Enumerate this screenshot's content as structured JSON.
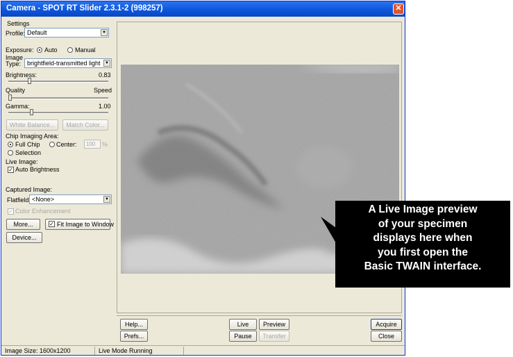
{
  "window": {
    "title": "Camera - SPOT RT Slider 2.3.1-2  (998257)"
  },
  "settings": {
    "group_label": "Settings",
    "profile_label": "Profile:",
    "profile_value": "Default",
    "exposure_label": "Exposure:",
    "exposure_auto": "Auto",
    "exposure_manual": "Manual",
    "exposure_selected": "Auto",
    "image_type_label_1": "Image",
    "image_type_label_2": "Type:",
    "image_type_value": "brightfield-transmitted light",
    "brightness_label": "Brightness:",
    "brightness_value": "0.83",
    "brightness_level": 0.2,
    "quality_label": "Quality",
    "speed_label": "Speed",
    "quality_level": 0.0,
    "gamma_label": "Gamma:",
    "gamma_value": "1.00",
    "gamma_level": 0.22,
    "white_balance_label": "White Balance...",
    "match_color_label": "Match Color...",
    "chip_area_label": "Chip Imaging Area:",
    "full_chip_label": "Full Chip",
    "center_label": "Center:",
    "center_value": "100",
    "center_unit": "%",
    "selection_label": "Selection",
    "live_image_label": "Live Image:",
    "auto_brightness_label": "Auto Brightness",
    "auto_brightness_checked": true
  },
  "captured": {
    "section_label": "Captured Image:",
    "flatfield_label": "Flatfield:",
    "flatfield_value": "<None>",
    "color_enhancement_label": "Color Enhancement",
    "more_label": "More...",
    "fit_label": "Fit Image to Window",
    "fit_checked": true,
    "device_label": "Device..."
  },
  "bottom_buttons": {
    "help": "Help...",
    "prefs": "Prefs...",
    "live": "Live",
    "pause": "Pause",
    "preview": "Preview",
    "transfer": "Transfer",
    "acquire": "Acquire",
    "close": "Close"
  },
  "status": {
    "image_size": "Image Size: 1600x1200",
    "mode": "Live Mode Running"
  },
  "callout": {
    "lines": [
      "A Live Image preview",
      "of your specimen",
      "displays here when",
      "you first open the",
      "Basic TWAIN interface."
    ]
  },
  "colors": {
    "titlebar": "#0b54d9",
    "window_bg": "#ece9d8",
    "close_button": "#e0542c",
    "callout_bg": "#000000",
    "specimen_tone": "#8e8e8e"
  },
  "icons": [
    "close-icon",
    "dropdown-arrow-icon",
    "checkmark-icon",
    "callout-pointer"
  ]
}
